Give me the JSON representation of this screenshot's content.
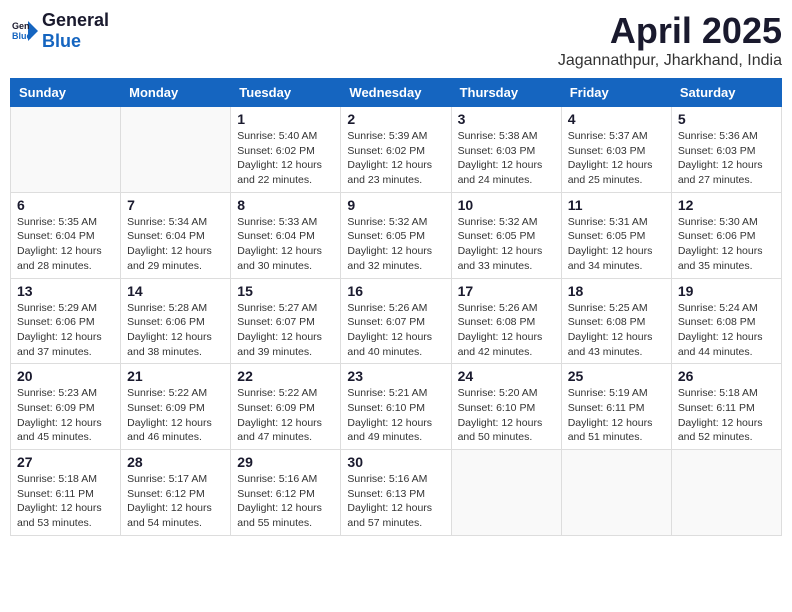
{
  "logo": {
    "general": "General",
    "blue": "Blue"
  },
  "title": "April 2025",
  "subtitle": "Jagannathpur, Jharkhand, India",
  "days_of_week": [
    "Sunday",
    "Monday",
    "Tuesday",
    "Wednesday",
    "Thursday",
    "Friday",
    "Saturday"
  ],
  "weeks": [
    [
      {
        "day": "",
        "info": ""
      },
      {
        "day": "",
        "info": ""
      },
      {
        "day": "1",
        "info": "Sunrise: 5:40 AM\nSunset: 6:02 PM\nDaylight: 12 hours and 22 minutes."
      },
      {
        "day": "2",
        "info": "Sunrise: 5:39 AM\nSunset: 6:02 PM\nDaylight: 12 hours and 23 minutes."
      },
      {
        "day": "3",
        "info": "Sunrise: 5:38 AM\nSunset: 6:03 PM\nDaylight: 12 hours and 24 minutes."
      },
      {
        "day": "4",
        "info": "Sunrise: 5:37 AM\nSunset: 6:03 PM\nDaylight: 12 hours and 25 minutes."
      },
      {
        "day": "5",
        "info": "Sunrise: 5:36 AM\nSunset: 6:03 PM\nDaylight: 12 hours and 27 minutes."
      }
    ],
    [
      {
        "day": "6",
        "info": "Sunrise: 5:35 AM\nSunset: 6:04 PM\nDaylight: 12 hours and 28 minutes."
      },
      {
        "day": "7",
        "info": "Sunrise: 5:34 AM\nSunset: 6:04 PM\nDaylight: 12 hours and 29 minutes."
      },
      {
        "day": "8",
        "info": "Sunrise: 5:33 AM\nSunset: 6:04 PM\nDaylight: 12 hours and 30 minutes."
      },
      {
        "day": "9",
        "info": "Sunrise: 5:32 AM\nSunset: 6:05 PM\nDaylight: 12 hours and 32 minutes."
      },
      {
        "day": "10",
        "info": "Sunrise: 5:32 AM\nSunset: 6:05 PM\nDaylight: 12 hours and 33 minutes."
      },
      {
        "day": "11",
        "info": "Sunrise: 5:31 AM\nSunset: 6:05 PM\nDaylight: 12 hours and 34 minutes."
      },
      {
        "day": "12",
        "info": "Sunrise: 5:30 AM\nSunset: 6:06 PM\nDaylight: 12 hours and 35 minutes."
      }
    ],
    [
      {
        "day": "13",
        "info": "Sunrise: 5:29 AM\nSunset: 6:06 PM\nDaylight: 12 hours and 37 minutes."
      },
      {
        "day": "14",
        "info": "Sunrise: 5:28 AM\nSunset: 6:06 PM\nDaylight: 12 hours and 38 minutes."
      },
      {
        "day": "15",
        "info": "Sunrise: 5:27 AM\nSunset: 6:07 PM\nDaylight: 12 hours and 39 minutes."
      },
      {
        "day": "16",
        "info": "Sunrise: 5:26 AM\nSunset: 6:07 PM\nDaylight: 12 hours and 40 minutes."
      },
      {
        "day": "17",
        "info": "Sunrise: 5:26 AM\nSunset: 6:08 PM\nDaylight: 12 hours and 42 minutes."
      },
      {
        "day": "18",
        "info": "Sunrise: 5:25 AM\nSunset: 6:08 PM\nDaylight: 12 hours and 43 minutes."
      },
      {
        "day": "19",
        "info": "Sunrise: 5:24 AM\nSunset: 6:08 PM\nDaylight: 12 hours and 44 minutes."
      }
    ],
    [
      {
        "day": "20",
        "info": "Sunrise: 5:23 AM\nSunset: 6:09 PM\nDaylight: 12 hours and 45 minutes."
      },
      {
        "day": "21",
        "info": "Sunrise: 5:22 AM\nSunset: 6:09 PM\nDaylight: 12 hours and 46 minutes."
      },
      {
        "day": "22",
        "info": "Sunrise: 5:22 AM\nSunset: 6:09 PM\nDaylight: 12 hours and 47 minutes."
      },
      {
        "day": "23",
        "info": "Sunrise: 5:21 AM\nSunset: 6:10 PM\nDaylight: 12 hours and 49 minutes."
      },
      {
        "day": "24",
        "info": "Sunrise: 5:20 AM\nSunset: 6:10 PM\nDaylight: 12 hours and 50 minutes."
      },
      {
        "day": "25",
        "info": "Sunrise: 5:19 AM\nSunset: 6:11 PM\nDaylight: 12 hours and 51 minutes."
      },
      {
        "day": "26",
        "info": "Sunrise: 5:18 AM\nSunset: 6:11 PM\nDaylight: 12 hours and 52 minutes."
      }
    ],
    [
      {
        "day": "27",
        "info": "Sunrise: 5:18 AM\nSunset: 6:11 PM\nDaylight: 12 hours and 53 minutes."
      },
      {
        "day": "28",
        "info": "Sunrise: 5:17 AM\nSunset: 6:12 PM\nDaylight: 12 hours and 54 minutes."
      },
      {
        "day": "29",
        "info": "Sunrise: 5:16 AM\nSunset: 6:12 PM\nDaylight: 12 hours and 55 minutes."
      },
      {
        "day": "30",
        "info": "Sunrise: 5:16 AM\nSunset: 6:13 PM\nDaylight: 12 hours and 57 minutes."
      },
      {
        "day": "",
        "info": ""
      },
      {
        "day": "",
        "info": ""
      },
      {
        "day": "",
        "info": ""
      }
    ]
  ]
}
